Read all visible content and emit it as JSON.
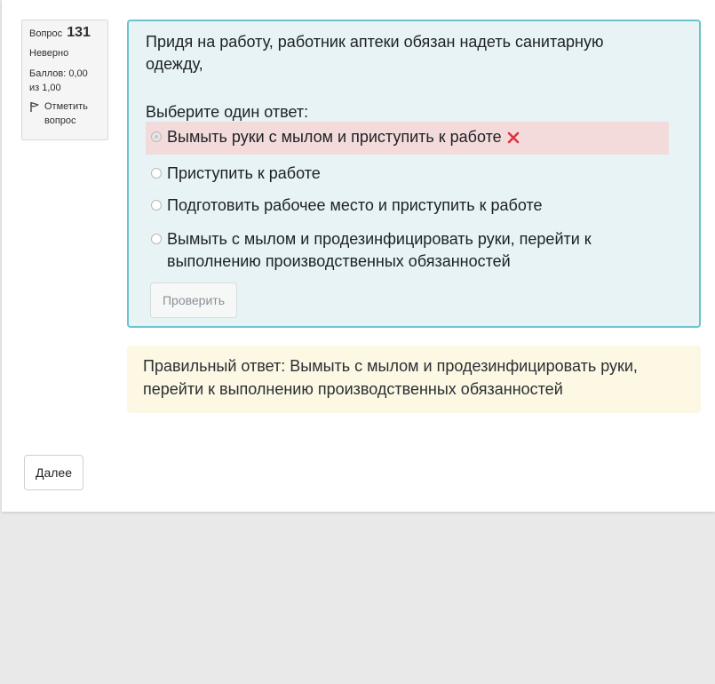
{
  "question_info": {
    "number_label": "Вопрос",
    "number": "131",
    "state": "Неверно",
    "grade": "Баллов: 0,00 из 1,00",
    "flag_label": "Отметить вопрос"
  },
  "question": {
    "text": "Придя на работу, работник аптеки обязан надеть санитарную одежду,",
    "prompt": "Выберите один ответ:",
    "answers": [
      {
        "label": "Вымыть руки с мылом и приступить к работе",
        "selected": true,
        "status": "incorrect"
      },
      {
        "label": "Приступить к работе",
        "selected": false,
        "status": ""
      },
      {
        "label": "Подготовить рабочее место и приступить к работе",
        "selected": false,
        "status": ""
      },
      {
        "label": "Вымыть с мылом и продезинфицировать руки, перейти к выполнению производственных обязанностей",
        "selected": false,
        "status": ""
      }
    ],
    "check_button": "Проверить"
  },
  "feedback": {
    "right_answer": "Правильный ответ: Вымыть с мылом и продезинфицировать руки, перейти к выполнению производственных обязанностей"
  },
  "navigation": {
    "next_button": "Далее"
  },
  "colors": {
    "formulation_bg": "#e7f3f5",
    "formulation_border": "#6bc3ce",
    "incorrect_bg": "#f4dbdb",
    "incorrect_icon": "#e3313c",
    "feedback_bg": "#fcf8e3"
  },
  "icons": {
    "flag": "flag-icon",
    "incorrect": "cross-icon"
  }
}
